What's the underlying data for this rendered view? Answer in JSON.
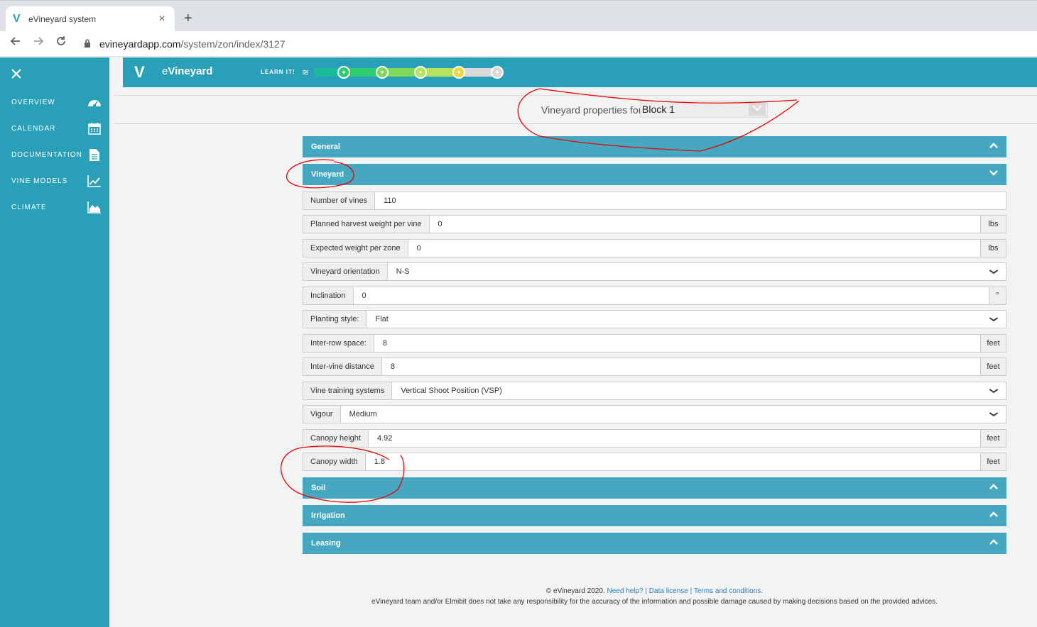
{
  "browser": {
    "tab_title": "eVineyard system",
    "tab_close": "×",
    "new_tab": "+",
    "url_domain": "evineyardapp.com",
    "url_path": "/system/zon/index/3127"
  },
  "sidebar": {
    "items": [
      {
        "label": "OVERVIEW",
        "icon": "dashboard-icon"
      },
      {
        "label": "CALENDAR",
        "icon": "calendar-icon"
      },
      {
        "label": "DOCUMENTATION",
        "icon": "document-icon"
      },
      {
        "label": "VINE MODELS",
        "icon": "chart-line-icon"
      },
      {
        "label": "CLIMATE",
        "icon": "area-chart-icon"
      }
    ]
  },
  "header": {
    "logo_v": "V",
    "brand_e": "e",
    "brand_rest": "Vineyard",
    "learn": "LEARN IT!",
    "stepper_colors": [
      "#1abc9c",
      "#2ecc71",
      "#7ed957",
      "#b5e35a",
      "#f5d33f",
      "#d9d9d9"
    ]
  },
  "properties": {
    "label": "Vineyard properties for",
    "block": "Block 1"
  },
  "sections": {
    "general": "General",
    "vineyard": "Vineyard",
    "soil": "Soil",
    "irrigation": "Irrigation",
    "leasing": "Leasing"
  },
  "fields": {
    "number_of_vines": {
      "label": "Number of vines",
      "value": "110"
    },
    "planned_harvest": {
      "label": "Planned harvest weight per vine",
      "value": "0",
      "unit": "lbs"
    },
    "expected_weight": {
      "label": "Expected weight per zone",
      "value": "0",
      "unit": "lbs"
    },
    "orientation": {
      "label": "Vineyard orientation",
      "value": "N-S"
    },
    "inclination": {
      "label": "Inclination",
      "value": "0",
      "unit": "°"
    },
    "planting_style": {
      "label": "Planting style:",
      "value": "Flat"
    },
    "inter_row": {
      "label": "Inter-row space:",
      "value": "8",
      "unit": "feet"
    },
    "inter_vine": {
      "label": "Inter-vine distance",
      "value": "8",
      "unit": "feet"
    },
    "training": {
      "label": "Vine training systems",
      "value": "Vertical Shoot Position (VSP)"
    },
    "vigour": {
      "label": "Vigour",
      "value": "Medium"
    },
    "canopy_height": {
      "label": "Canopy height",
      "value": "4.92",
      "unit": "feet"
    },
    "canopy_width": {
      "label": "Canopy width",
      "value": "1.8",
      "unit": "feet"
    }
  },
  "footer": {
    "copyright": "© eVineyard 2020.",
    "need_help": "Need help?",
    "sep1": " | ",
    "data_license": "Data license",
    "sep2": " | ",
    "terms": "Terms and conditions.",
    "disclaimer": "eVineyard team and/or Elmibit does not take any responsibility for the accuracy of the information and possible damage caused by making decisions based on the provided advices."
  }
}
